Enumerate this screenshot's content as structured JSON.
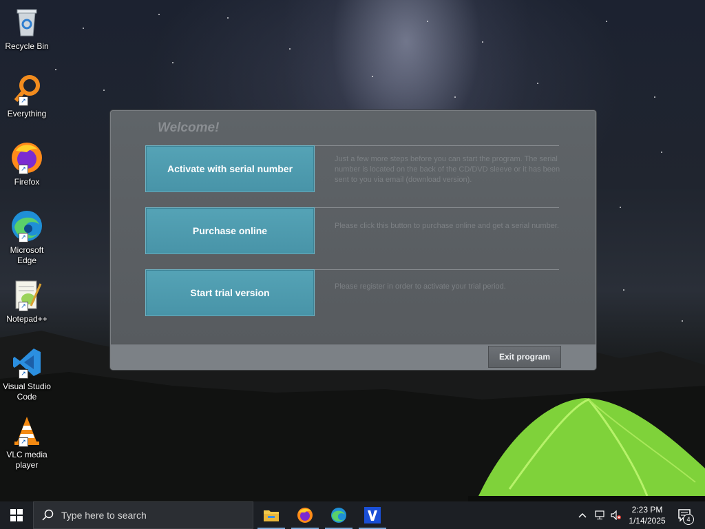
{
  "desktop": {
    "icons": [
      {
        "label": "Recycle Bin",
        "icon": "recycle-bin-icon"
      },
      {
        "label": "Everything",
        "icon": "everything-search-icon"
      },
      {
        "label": "Firefox",
        "icon": "firefox-icon"
      },
      {
        "label": "Microsoft Edge",
        "icon": "edge-icon"
      },
      {
        "label": "Notepad++",
        "icon": "notepad-plus-plus-icon"
      },
      {
        "label": "Visual Studio Code",
        "icon": "vscode-icon"
      },
      {
        "label": "VLC media player",
        "icon": "vlc-icon"
      }
    ]
  },
  "dialog": {
    "heading": "Welcome!",
    "actions": [
      {
        "label": "Activate with serial number",
        "description": "Just a few more steps before you can start the program. The serial number is located on the back of the CD/DVD sleeve or it has been sent to you via email (download version)."
      },
      {
        "label": "Purchase online",
        "description": "Please click this button to purchase online and get a serial number."
      },
      {
        "label": "Start trial version",
        "description": "Please register in order to activate your trial period."
      }
    ],
    "exit_label": "Exit program"
  },
  "taskbar": {
    "search_placeholder": "Type here to search",
    "apps": [
      "file-explorer-icon",
      "firefox-icon",
      "edge-icon",
      "app-v-icon"
    ],
    "clock": {
      "time": "2:23 PM",
      "date": "1/14/2025"
    },
    "notification_count": "4"
  },
  "colors": {
    "accent_button": "#4f9db1",
    "taskbar": "#1c1f24",
    "tent": "#8fe33a"
  }
}
